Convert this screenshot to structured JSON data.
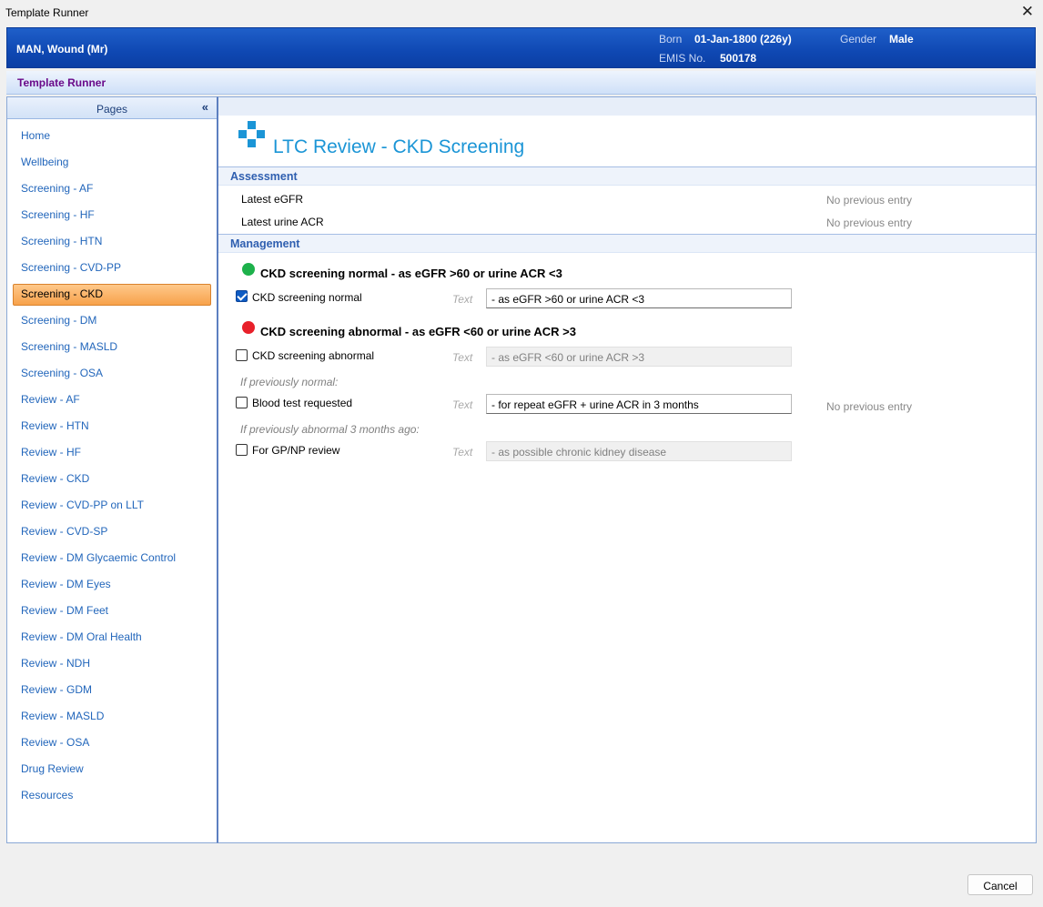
{
  "window": {
    "title": "Template Runner",
    "close_glyph": "✕"
  },
  "patient": {
    "name": "MAN, Wound (Mr)",
    "born_label": "Born",
    "born_value": "01-Jan-1800 (226y)",
    "gender_label": "Gender",
    "gender_value": "Male",
    "emis_label": "EMIS No.",
    "emis_value": "500178"
  },
  "header": {
    "title": "Template Runner"
  },
  "pages": {
    "title": "Pages",
    "collapse_glyph": "«",
    "items": [
      {
        "label": "Home"
      },
      {
        "label": "Wellbeing"
      },
      {
        "label": "Screening - AF"
      },
      {
        "label": "Screening - HF"
      },
      {
        "label": "Screening - HTN"
      },
      {
        "label": "Screening - CVD-PP"
      },
      {
        "label": "Screening - CKD",
        "active": true
      },
      {
        "label": "Screening - DM"
      },
      {
        "label": "Screening - MASLD"
      },
      {
        "label": "Screening - OSA"
      },
      {
        "label": "Review - AF"
      },
      {
        "label": "Review - HTN"
      },
      {
        "label": "Review - HF"
      },
      {
        "label": "Review - CKD"
      },
      {
        "label": "Review - CVD-PP on LLT"
      },
      {
        "label": "Review - CVD-SP"
      },
      {
        "label": "Review - DM Glycaemic Control"
      },
      {
        "label": "Review - DM Eyes"
      },
      {
        "label": "Review - DM Feet"
      },
      {
        "label": "Review - DM Oral Health"
      },
      {
        "label": "Review - NDH"
      },
      {
        "label": "Review - GDM"
      },
      {
        "label": "Review - MASLD"
      },
      {
        "label": "Review - OSA"
      },
      {
        "label": "Drug Review"
      },
      {
        "label": "Resources"
      }
    ]
  },
  "content": {
    "page_title": "LTC Review - CKD Screening",
    "logo_icon": "medical-cross-icon",
    "assessment": {
      "title": "Assessment",
      "rows": [
        {
          "label": "Latest eGFR",
          "value": "No previous entry"
        },
        {
          "label": "Latest urine ACR",
          "value": "No previous entry"
        }
      ]
    },
    "management": {
      "title": "Management",
      "normal_heading": "CKD screening normal - as eGFR >60 or urine ACR <3",
      "normal_color": "#1db14b",
      "abnormal_heading": "CKD screening abnormal - as eGFR <60 or urine ACR >3",
      "abnormal_color": "#e8202a",
      "text_label": "Text",
      "items": [
        {
          "label": "CKD screening normal",
          "checked": true,
          "text": "- as eGFR >60 or urine ACR <3",
          "enabled": true
        },
        {
          "label": "CKD screening abnormal",
          "checked": false,
          "text": "- as eGFR <60 or urine ACR >3",
          "enabled": false
        },
        {
          "label": "Blood test requested",
          "checked": false,
          "text": "- for repeat eGFR + urine ACR in 3 months",
          "enabled": true,
          "previous": "No previous entry"
        },
        {
          "label": "For GP/NP review",
          "checked": false,
          "text": "- as possible chronic kidney disease",
          "enabled": false
        }
      ],
      "hint_normal": "If previously normal:",
      "hint_abnormal": "If previously abnormal 3 months ago:"
    }
  },
  "footer": {
    "cancel_label": "Cancel"
  }
}
